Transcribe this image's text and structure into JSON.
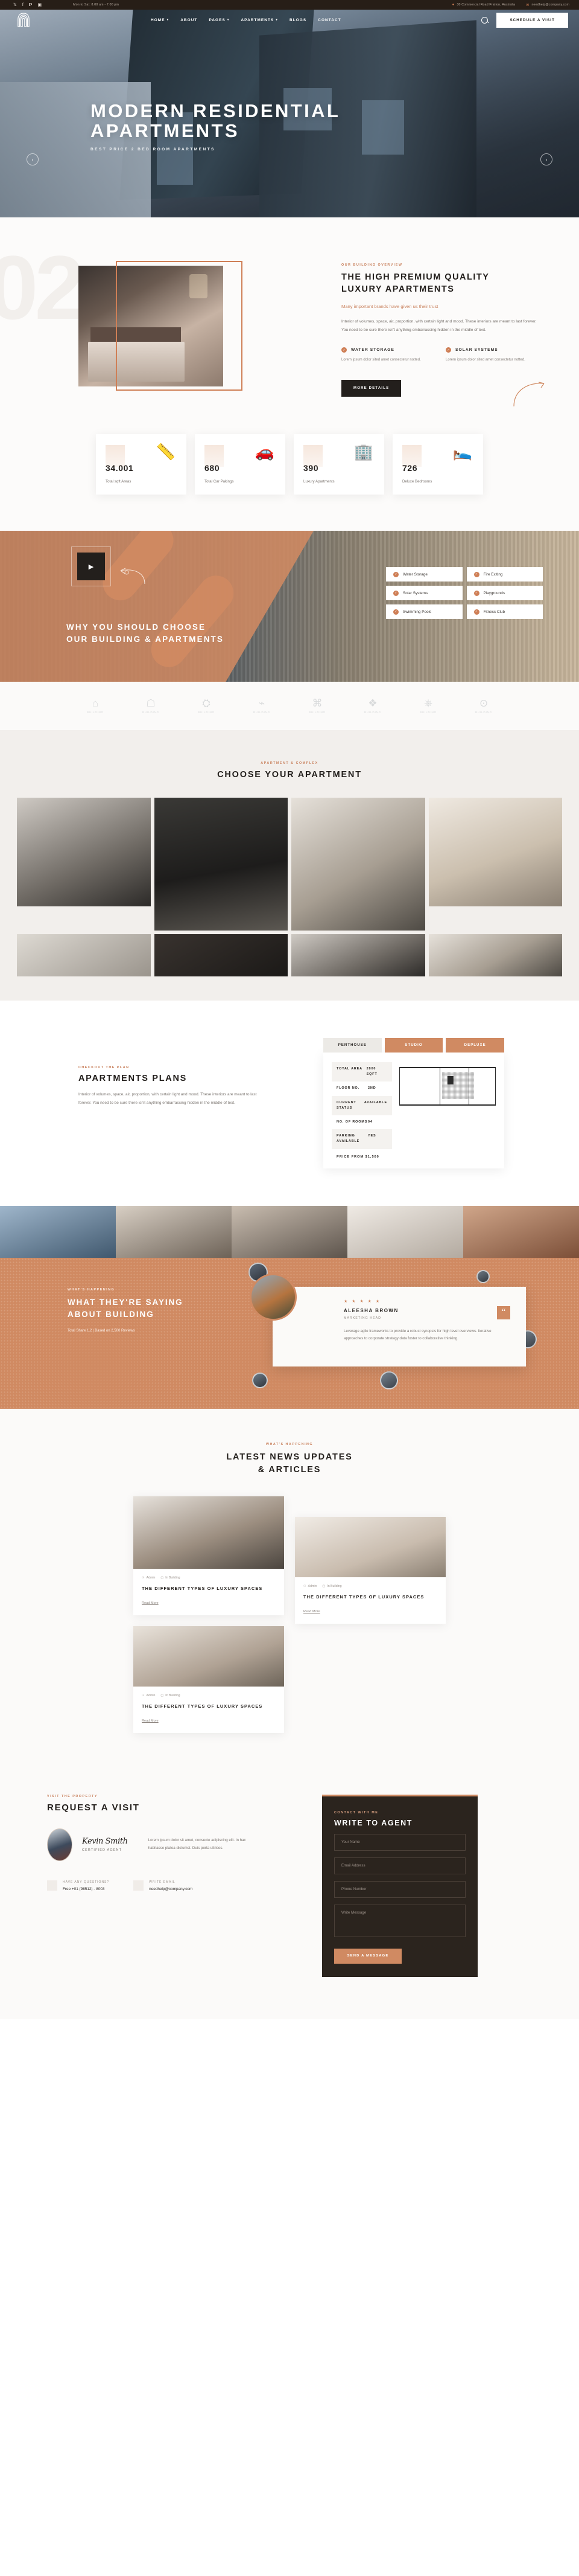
{
  "topbar": {
    "social": [
      "twitter-icon",
      "facebook-icon",
      "pinterest-icon",
      "instagram-icon"
    ],
    "hours": "Mon to Sat: 8.00 am - 7.00 pm",
    "address": "30 Commercial Road Fratton, Australia",
    "email": "needhelp@company.com"
  },
  "nav": {
    "items": [
      {
        "label": "HOME",
        "caret": "▾"
      },
      {
        "label": "ABOUT",
        "caret": ""
      },
      {
        "label": "PAGES",
        "caret": "▾"
      },
      {
        "label": "APARTMENTS",
        "caret": "▾"
      },
      {
        "label": "BLOGS",
        "caret": ""
      },
      {
        "label": "CONTACT",
        "caret": ""
      }
    ],
    "cta": "SCHEDULE A VISIT"
  },
  "hero": {
    "title_line1": "MODERN RESIDENTIAL",
    "title_line2": "APARTMENTS",
    "subtitle": "BEST PRICE 2 BED ROOM APARTMENTS",
    "prev": "‹",
    "next": "›",
    "ghost_number": "02"
  },
  "overview": {
    "eyebrow": "OUR BUILDING OVERVIEW",
    "title_line1": "THE HIGH PREMIUM QUALITY",
    "title_line2": "LUXURY APARTMENTS",
    "trust": "Many important brands have given us their trust",
    "paragraph": "Interior of volumes, space, air, proportion, with certain light and mood. These interiors are meant to last forever. You need to be sure there isn't anything embarrassing hidden in the middle of text.",
    "features": [
      {
        "title": "WATER STORAGE",
        "desc": "Lorem ipsum dolor sited amet consectetur notted."
      },
      {
        "title": "SOLAR SYSTEMS",
        "desc": "Lorem ipsum dolor sited amet consectetur notted."
      }
    ],
    "button": "MORE DETAILS"
  },
  "stats": [
    {
      "number": "34.001",
      "label": "Total sqft Areas",
      "icon": "ruler-pencil-icon"
    },
    {
      "number": "680",
      "label": "Total Car Pakings",
      "icon": "parking-car-icon"
    },
    {
      "number": "390",
      "label": "Luxury Apartments",
      "icon": "building-icon"
    },
    {
      "number": "726",
      "label": "Deluxe Bedrooms",
      "icon": "bed-icon"
    }
  ],
  "why": {
    "title_line1": "WHY YOU SHOULD CHOOSE",
    "title_line2": "OUR BUILDING & APARTMENTS",
    "play": "▶",
    "amenities": [
      "Water Storage",
      "Fire Exiting",
      "Solar Systems",
      "Playgrounds",
      "Swimming Pools",
      "Fitness Club"
    ]
  },
  "brands": [
    {
      "glyph": "⌂",
      "name": "BUILDING"
    },
    {
      "glyph": "☖",
      "name": "BUILDING"
    },
    {
      "glyph": "⛭",
      "name": "BUILDING"
    },
    {
      "glyph": "⌁",
      "name": "BUILDING"
    },
    {
      "glyph": "⌘",
      "name": "BUILDING"
    },
    {
      "glyph": "❖",
      "name": "BUILDING"
    },
    {
      "glyph": "⎈",
      "name": "BUILDING"
    },
    {
      "glyph": "⊙",
      "name": "BUILDING"
    }
  ],
  "choose": {
    "eyebrow": "APARTMENT & COMPLEX",
    "title": "CHOOSE YOUR APARTMENT"
  },
  "plans": {
    "eyebrow": "CHECKOUT THE PLAN",
    "title": "APARTMENTS PLANS",
    "paragraph": "Interior of volumes, space, air, proportion, with certain light and mood. These interiors are meant to last forever. You need to be sure there isn't anything embarrassing hidden in the middle of text.",
    "tabs": [
      {
        "label": "PENTHOUSE",
        "active": true
      },
      {
        "label": "STUDIO",
        "active": false
      },
      {
        "label": "DEPLUXE",
        "active": false
      }
    ],
    "specs": [
      {
        "key": "TOTAL AREA",
        "value": "2800 SQFT"
      },
      {
        "key": "FLOOR NO.",
        "value": "2ND"
      },
      {
        "key": "CURRENT STATUS",
        "value": "AVAILABLE"
      },
      {
        "key": "NO. OF ROOMS",
        "value": "04"
      },
      {
        "key": "PARKING AVAILABLE",
        "value": "YES"
      }
    ],
    "price": "PRICE FROM $1,500"
  },
  "testimonial": {
    "eyebrow": "WHAT'S HAPPENING",
    "title_line1": "WHAT THEY'RE SAYING",
    "title_line2": "ABOUT BUILDING",
    "subtitle": "Total Share 1.2 | Based on 2,500 Reviews",
    "stars": "★ ★ ★ ★ ★",
    "name": "ALEESHA BROWN",
    "role": "MARKETING HEAD",
    "quote": "Leverage agile frameworks to provide a robust synopsis for high level overviews. Iterative approaches to corporate strategy data foster to collaborative thinking.",
    "quote_mark": "“"
  },
  "news": {
    "eyebrow": "WHAT'S HAPPENING",
    "title_line1": "LATEST NEWS UPDATES",
    "title_line2": "& ARTICLES",
    "cards": [
      {
        "admin": "Admin",
        "category": "In Building",
        "title": "THE DIFFERENT TYPES OF LUXURY SPACES",
        "read": "Read More"
      },
      {
        "admin": "Admin",
        "category": "In Building",
        "title": "THE DIFFERENT TYPES OF LUXURY SPACES",
        "read": "Read More"
      },
      {
        "admin": "Admin",
        "category": "In Building",
        "title": "THE DIFFERENT TYPES OF LUXURY SPACES",
        "read": "Read More"
      }
    ]
  },
  "visit": {
    "eyebrow": "VISIT THE PROPERTY",
    "title": "REQUEST A VISIT",
    "agent_name": "Kevin Smith",
    "agent_role": "CERTIFIED AGENT",
    "agent_text": "Lorem ipsum dolor sit amet, consecte adipiscing elit. In hac habitasse platea dictumst. Duis porta ultrices.",
    "contacts": [
      {
        "key": "HAVE ANY QUESTIONS?",
        "value": "Free +01 (98512) - 8003"
      },
      {
        "key": "WRITE EMAIL",
        "value": "needhelp@company.com"
      }
    ],
    "form": {
      "eyebrow": "CONTACT WITH ME",
      "title": "WRITE TO AGENT",
      "name_placeholder": "Your Name",
      "email_placeholder": "Email Address",
      "phone_placeholder": "Phone Number",
      "message_placeholder": "Write Message",
      "submit": "SEND A MESSAGE"
    }
  },
  "colors": {
    "accent": "#d08a62",
    "dark": "#231f1c",
    "light": "#fbfaf9"
  }
}
